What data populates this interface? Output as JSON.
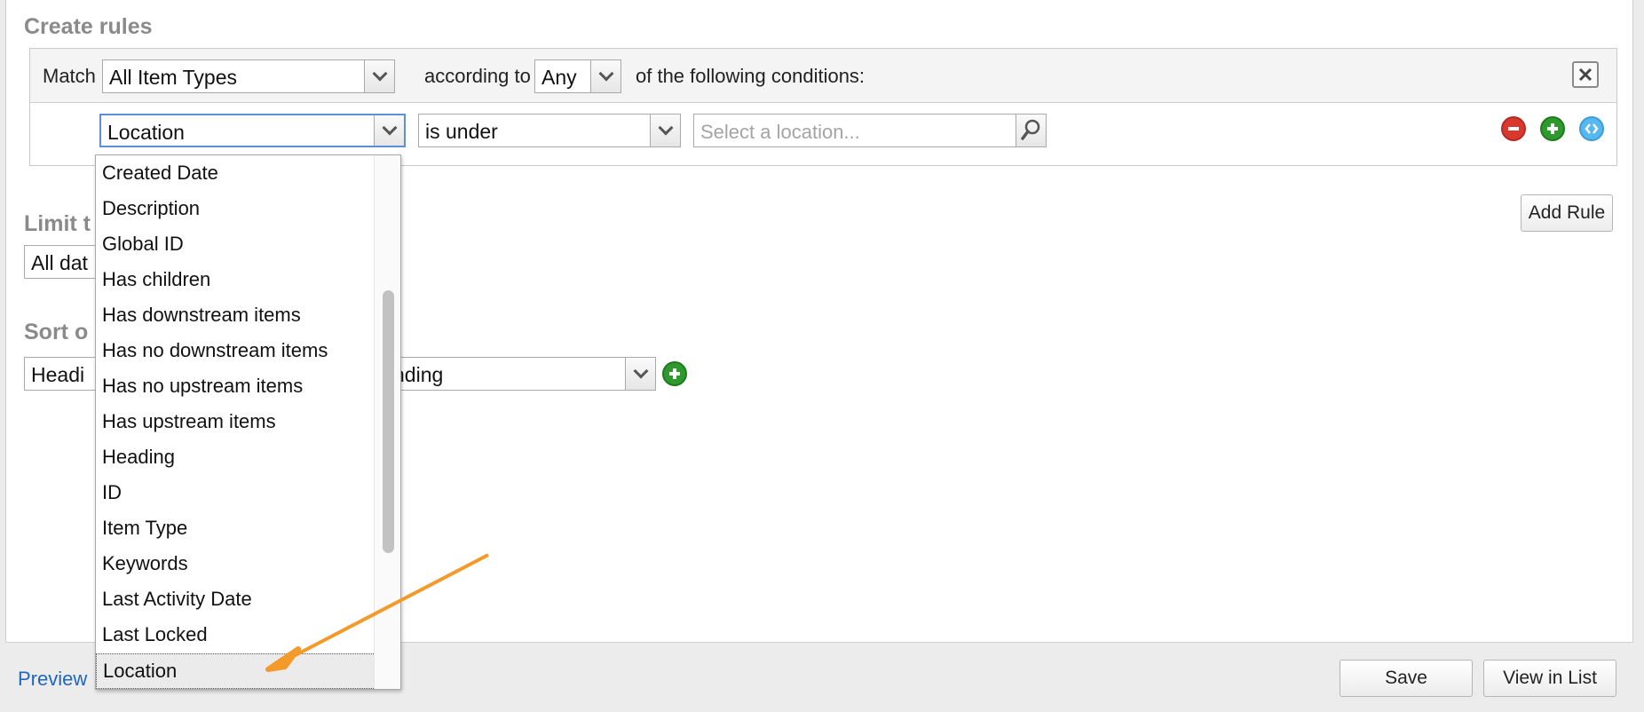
{
  "create_rules": {
    "title": "Create rules",
    "match_label": "Match",
    "match_value": "All Item Types",
    "according_label": "according to",
    "according_value": "Any",
    "conditions_label": "of the following conditions:"
  },
  "rule": {
    "field_value": "Location",
    "operator_value": "is under",
    "location_placeholder": "Select a location..."
  },
  "limit": {
    "title_visible": "Limit t",
    "value_visible": "All dat"
  },
  "sort": {
    "title_visible": "Sort o",
    "field_visible": "Headi",
    "order_visible": "nding"
  },
  "add_rule_label": "Add Rule",
  "footer": {
    "preview_label": "Preview",
    "save_label": "Save",
    "view_in_list_label": "View in List"
  },
  "dropdown": {
    "items": [
      "Created Date",
      "Description",
      "Global ID",
      "Has children",
      "Has downstream items",
      "Has no downstream items",
      "Has no upstream items",
      "Has upstream items",
      "Heading",
      "ID",
      "Item Type",
      "Keywords",
      "Last Activity Date",
      "Last Locked",
      "Location"
    ],
    "selected": "Location"
  },
  "colors": {
    "remove_icon": "#d9382f",
    "add_icon": "#2e9a2e",
    "move_icon": "#57b8f0",
    "annotation_arrow": "#f39a2b",
    "link": "#1f66c2"
  }
}
